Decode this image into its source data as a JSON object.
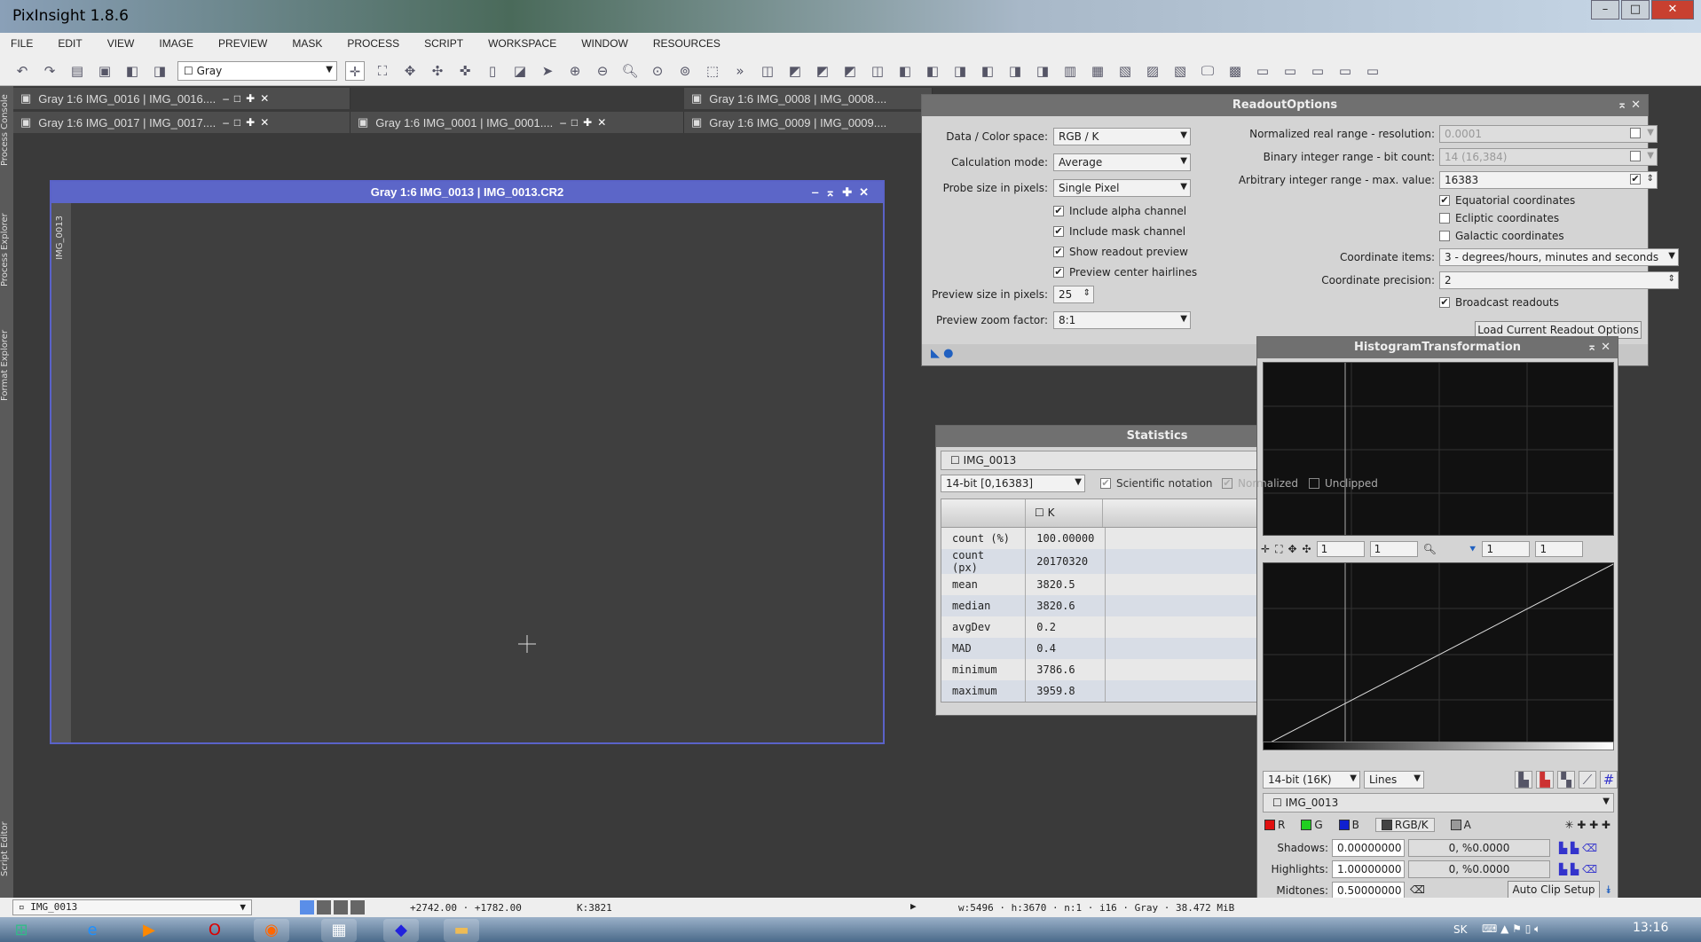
{
  "app": {
    "title": "PixInsight 1.8.6"
  },
  "menu": [
    "FILE",
    "EDIT",
    "VIEW",
    "IMAGE",
    "PREVIEW",
    "MASK",
    "PROCESS",
    "SCRIPT",
    "WORKSPACE",
    "WINDOW",
    "RESOURCES"
  ],
  "toolbar": {
    "view_selector": "Gray"
  },
  "tabs": {
    "row1": [
      {
        "label": "Gray 1:6 IMG_0016 | IMG_0016...."
      },
      {
        "label": "Gray 1:6 IMG_0008 | IMG_0008...."
      }
    ],
    "row2": [
      {
        "label": "Gray 1:6 IMG_0017 | IMG_0017...."
      },
      {
        "label": "Gray 1:6 IMG_0001 | IMG_0001...."
      },
      {
        "label": "Gray 1:6 IMG_0009 | IMG_0009...."
      }
    ]
  },
  "side_tabs": [
    "Process Console",
    "Process Explorer",
    "Format Explorer",
    "Script Editor"
  ],
  "image_window": {
    "title": "Gray 1:6 IMG_0013 | IMG_0013.CR2",
    "side_label": "IMG_0013"
  },
  "readout": {
    "title": "ReadoutOptions",
    "data_color_space_label": "Data / Color space:",
    "data_color_space": "RGB / K",
    "calc_mode_label": "Calculation mode:",
    "calc_mode": "Average",
    "probe_size_label": "Probe size in pixels:",
    "probe_size": "Single Pixel",
    "checks_left": [
      {
        "label": "Include alpha channel",
        "checked": true
      },
      {
        "label": "Include mask channel",
        "checked": true
      },
      {
        "label": "Show readout preview",
        "checked": true
      },
      {
        "label": "Preview center hairlines",
        "checked": true
      }
    ],
    "preview_size_label": "Preview size in pixels:",
    "preview_size": "25",
    "preview_zoom_label": "Preview zoom factor:",
    "preview_zoom": "8:1",
    "norm_real_label": "Normalized real range - resolution:",
    "norm_real": "0.0001",
    "binary_int_label": "Binary integer range - bit count:",
    "binary_int": "14 (16,384)",
    "arb_int_label": "Arbitrary integer range - max. value:",
    "arb_int": "16383",
    "checks_right": [
      {
        "label": "Equatorial coordinates",
        "checked": true
      },
      {
        "label": "Ecliptic coordinates",
        "checked": false
      },
      {
        "label": "Galactic coordinates",
        "checked": false
      }
    ],
    "coord_items_label": "Coordinate items:",
    "coord_items": "3 - degrees/hours, minutes and seconds",
    "coord_precision_label": "Coordinate precision:",
    "coord_precision": "2",
    "broadcast": {
      "label": "Broadcast readouts",
      "checked": true
    },
    "load_button": "Load Current Readout Options"
  },
  "statistics": {
    "title": "Statistics",
    "view": "IMG_0013",
    "range": "14-bit [0,16383]",
    "scientific": "Scientific notation",
    "normalized": "Normalized",
    "unclipped": "Unclipped",
    "column": "K",
    "rows": [
      [
        "count (%)",
        "100.00000"
      ],
      [
        "count (px)",
        "20170320"
      ],
      [
        "mean",
        "3820.5"
      ],
      [
        "median",
        "3820.6"
      ],
      [
        "avgDev",
        "0.2"
      ],
      [
        "MAD",
        "0.4"
      ],
      [
        "minimum",
        "3786.6"
      ],
      [
        "maximum",
        "3959.8"
      ]
    ]
  },
  "histogram": {
    "title": "HistogramTransformation",
    "zoom_h": "1",
    "zoom_v": "1",
    "zoom_h2": "1",
    "zoom_v2": "1",
    "resolution": "14-bit (16K)",
    "graph_style": "Lines",
    "view": "IMG_0013",
    "channels": [
      {
        "label": "R",
        "color": "#e01010"
      },
      {
        "label": "G",
        "color": "#20d020"
      },
      {
        "label": "B",
        "color": "#1020d0"
      },
      {
        "label": "RGB/K",
        "color": "#444"
      },
      {
        "label": "A",
        "color": "#999"
      }
    ],
    "shadows_label": "Shadows:",
    "shadows": "0.00000000",
    "shadows_clip": "0, %0.0000",
    "highlights_label": "Highlights:",
    "highlights": "1.00000000",
    "highlights_clip": "0, %0.0000",
    "midtones_label": "Midtones:",
    "midtones": "0.50000000",
    "auto_clip": "Auto Clip Setup"
  },
  "statusbar": {
    "view": "IMG_0013",
    "coords": "+2742.00 · +1782.00",
    "value": "K:3821",
    "info": "w:5496 · h:3670 · n:1 · i16 · Gray · 38.472 MiB"
  },
  "taskbar": {
    "lang": "SK",
    "clock": "13:16"
  }
}
